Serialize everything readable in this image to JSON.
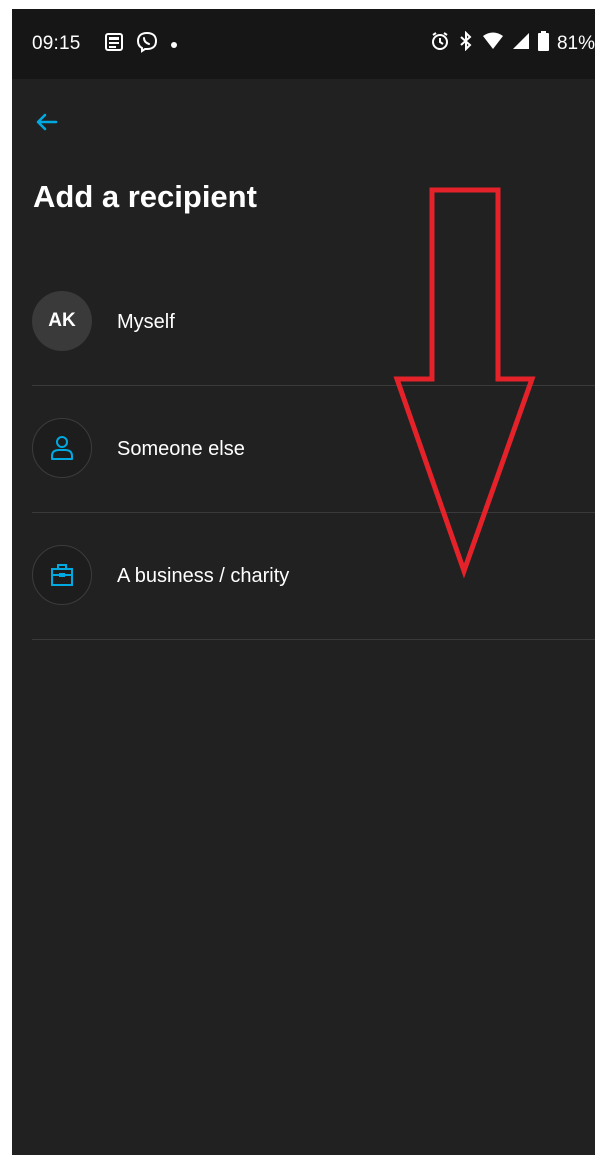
{
  "status_bar": {
    "time": "09:15",
    "battery": "81%",
    "left_icons": [
      "news-icon",
      "viber-icon",
      "notification-dot-icon"
    ],
    "right_icons": [
      "alarm-icon",
      "bluetooth-icon",
      "wifi-icon",
      "signal-icon",
      "battery-icon"
    ]
  },
  "header": {
    "back_icon": "arrow-left-icon",
    "title": "Add a recipient"
  },
  "recipients": [
    {
      "avatar": "AK",
      "label": "Myself"
    },
    {
      "icon": "person-icon",
      "label": "Someone else"
    },
    {
      "icon": "briefcase-icon",
      "label": "A business / charity"
    }
  ],
  "overlay": {
    "annotation_icon": "down-arrow-annotation",
    "color": "#e5222a"
  },
  "colors": {
    "background": "#212121",
    "status_bar": "#161616",
    "accent": "#00a9e0",
    "text": "#ffffff",
    "divider": "#3a3a3a"
  }
}
